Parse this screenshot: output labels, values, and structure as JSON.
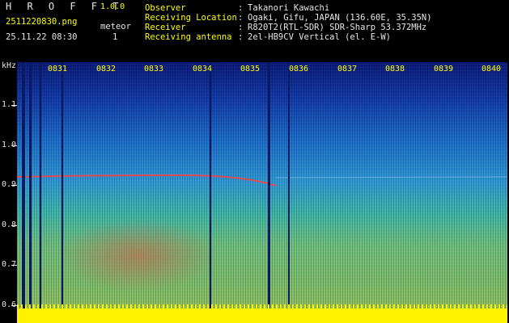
{
  "header": {
    "app_name": "H R O F F T",
    "version": "1.0.0",
    "filename": "2511220830.png",
    "datetime": "25.11.22 08:30",
    "meteor_label": "meteor",
    "meteor_count": "1",
    "info": [
      {
        "label": "Observer",
        "value": "Takanori Kawachi"
      },
      {
        "label": "Receiving Location",
        "value": "Ogaki, Gifu, JAPAN (136.60E, 35.35N)"
      },
      {
        "label": "Receiver",
        "value": "R820T2(RTL-SDR) SDR-Sharp 53.372MHz"
      },
      {
        "label": "Receiving antenna",
        "value": "2el-HB9CV Vertical (el. E-W)"
      }
    ]
  },
  "axis": {
    "unit": "kHz",
    "x_ticks": [
      "0831",
      "0832",
      "0833",
      "0834",
      "0835",
      "0836",
      "0837",
      "0838",
      "0839",
      "0840"
    ],
    "y_ticks": [
      "1.1",
      "1.0",
      "0.9",
      "0.8",
      "0.7",
      "0.6"
    ]
  },
  "colors": {
    "accent": "#ffff00",
    "text": "#e6e6e6",
    "background": "#000000"
  }
}
